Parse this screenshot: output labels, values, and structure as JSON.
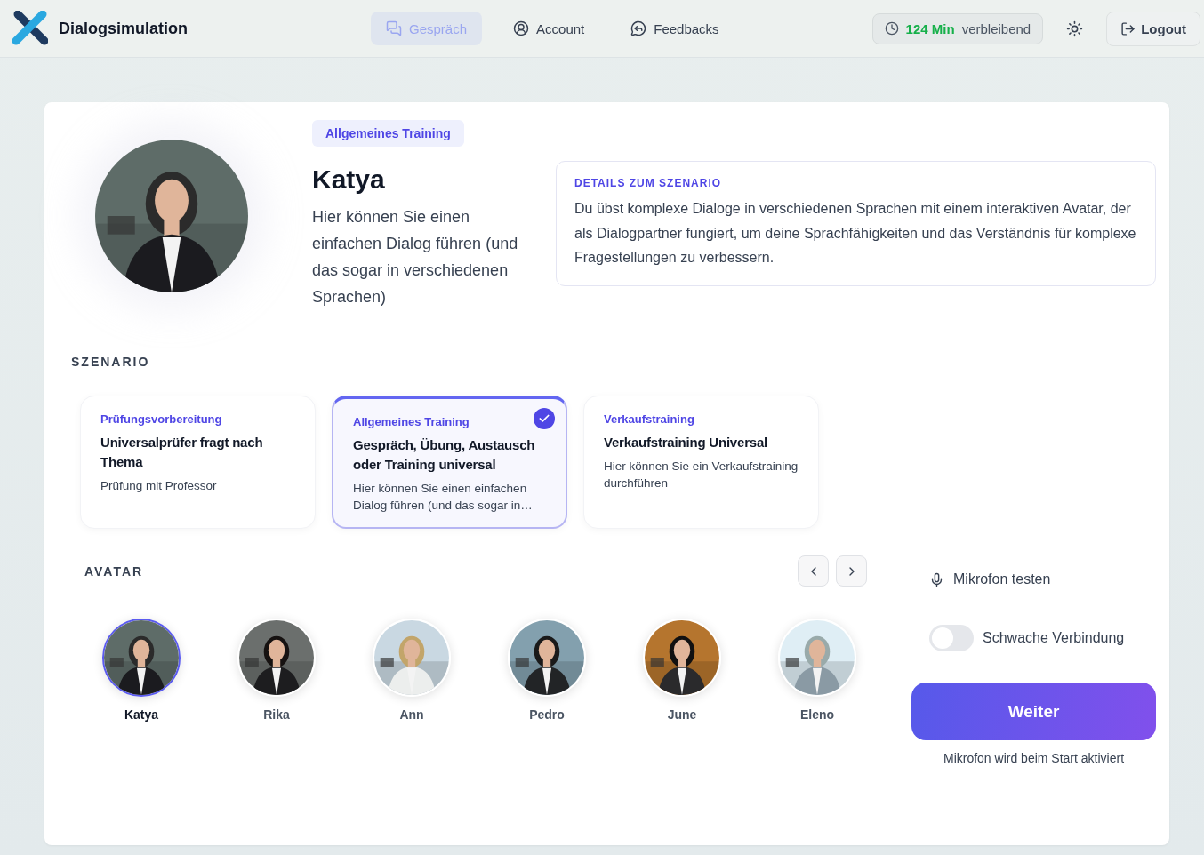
{
  "app": {
    "title": "Dialogsimulation"
  },
  "nav": [
    {
      "label": "Gespräch",
      "selected": true
    },
    {
      "label": "Account",
      "selected": false
    },
    {
      "label": "Feedbacks",
      "selected": false
    }
  ],
  "time": {
    "amount": "124 Min",
    "label": "verbleibend"
  },
  "logout": "Logout",
  "hero": {
    "tag": "Allgemeines Training",
    "name": "Katya",
    "description": "Hier können Sie einen einfachen Dialog führen (und das sogar in verschiedenen Sprachen)",
    "details_title": "DETAILS ZUM SZENARIO",
    "details": "Du übst komplexe Dialoge in verschiedenen Sprachen mit einem interaktiven Avatar, der als Dialogpartner fungiert, um deine Sprachfähigkeiten und das Verständnis für komplexe Fragestellungen zu verbessern."
  },
  "scenario_heading": "SZENARIO",
  "scenarios": [
    {
      "category": "Prüfungsvorbereitung",
      "title": "Universalprüfer fragt nach Thema",
      "description": "Prüfung mit Professor",
      "selected": false
    },
    {
      "category": "Allgemeines Training",
      "title": "Gespräch, Übung, Austausch oder Training universal",
      "description": "Hier können Sie einen einfachen Dialog führen (und das sogar in…",
      "selected": true
    },
    {
      "category": "Verkaufstraining",
      "title": "Verkaufstraining Universal",
      "description": "Hier können Sie ein Verkaufstraining durchführen",
      "selected": false
    }
  ],
  "avatar_heading": "AVATAR",
  "avatars": [
    {
      "name": "Katya",
      "selected": true
    },
    {
      "name": "Rika",
      "selected": false
    },
    {
      "name": "Ann",
      "selected": false
    },
    {
      "name": "Pedro",
      "selected": false
    },
    {
      "name": "June",
      "selected": false
    },
    {
      "name": "Eleno",
      "selected": false
    }
  ],
  "mic_test": "Mikrofon testen",
  "weak_connection": {
    "label": "Schwache Verbindung",
    "on": false
  },
  "continue_button": "Weiter",
  "mic_note": "Mikrofon wird beim Start aktiviert"
}
